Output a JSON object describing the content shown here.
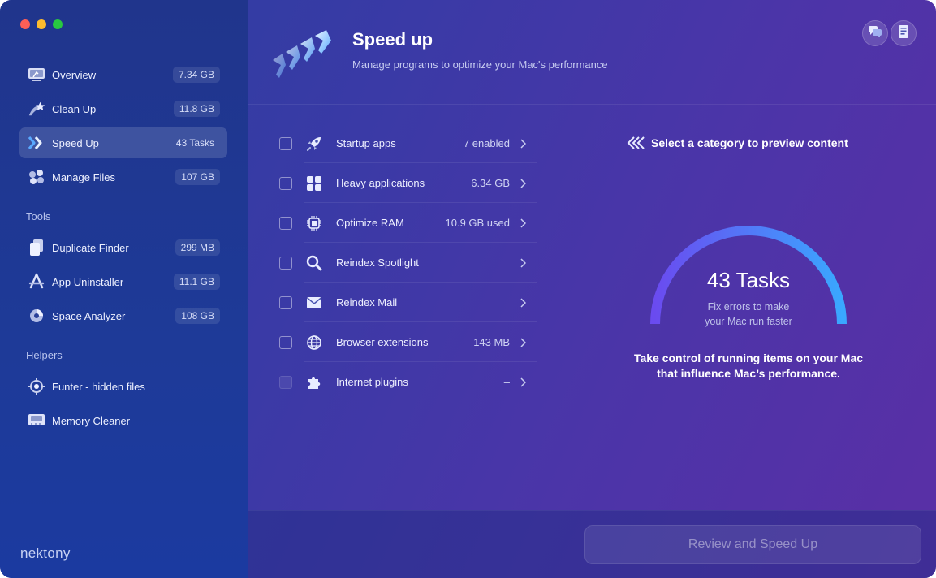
{
  "sidebar": {
    "main_items": [
      {
        "label": "Overview",
        "badge": "7.34 GB",
        "icon": "overview-icon"
      },
      {
        "label": "Clean Up",
        "badge": "11.8 GB",
        "icon": "clean-up-icon"
      },
      {
        "label": "Speed Up",
        "badge": "43 Tasks",
        "icon": "speed-up-icon",
        "active": true
      },
      {
        "label": "Manage Files",
        "badge": "107 GB",
        "icon": "manage-files-icon"
      }
    ],
    "tools_title": "Tools",
    "tools": [
      {
        "label": "Duplicate Finder",
        "badge": "299 MB",
        "icon": "duplicate-finder-icon"
      },
      {
        "label": "App Uninstaller",
        "badge": "11.1 GB",
        "icon": "app-uninstaller-icon"
      },
      {
        "label": "Space Analyzer",
        "badge": "108 GB",
        "icon": "space-analyzer-icon"
      }
    ],
    "helpers_title": "Helpers",
    "helpers": [
      {
        "label": "Funter - hidden files",
        "icon": "funter-icon"
      },
      {
        "label": "Memory Cleaner",
        "icon": "memory-cleaner-icon"
      }
    ],
    "logo": "nektony"
  },
  "header": {
    "title": "Speed up",
    "subtitle": "Manage programs to optimize your Mac's performance"
  },
  "tasks": [
    {
      "label": "Startup apps",
      "value": "7 enabled",
      "icon": "rocket-icon"
    },
    {
      "label": "Heavy applications",
      "value": "6.34 GB",
      "icon": "apps-grid-icon"
    },
    {
      "label": "Optimize RAM",
      "value": "10.9 GB used",
      "icon": "chip-icon"
    },
    {
      "label": "Reindex Spotlight",
      "value": "",
      "icon": "magnifier-icon"
    },
    {
      "label": "Reindex Mail",
      "value": "",
      "icon": "mail-icon"
    },
    {
      "label": "Browser extensions",
      "value": "143 MB",
      "icon": "globe-icon"
    },
    {
      "label": "Internet plugins",
      "value": "–",
      "icon": "puzzle-icon",
      "disabled": true
    }
  ],
  "preview": {
    "hint": "Select a category to preview content",
    "gauge_title": "43 Tasks",
    "gauge_sub_line1": "Fix errors to make",
    "gauge_sub_line2": "your Mac run faster",
    "desc_line1": "Take control of running items on your Mac",
    "desc_line2": "that influence Mac’s performance."
  },
  "footer": {
    "cta_label": "Review and Speed Up"
  },
  "colors": {
    "gauge_start": "#6a4bf0",
    "gauge_end": "#3aa7ff",
    "accent": "#3d8bff"
  }
}
